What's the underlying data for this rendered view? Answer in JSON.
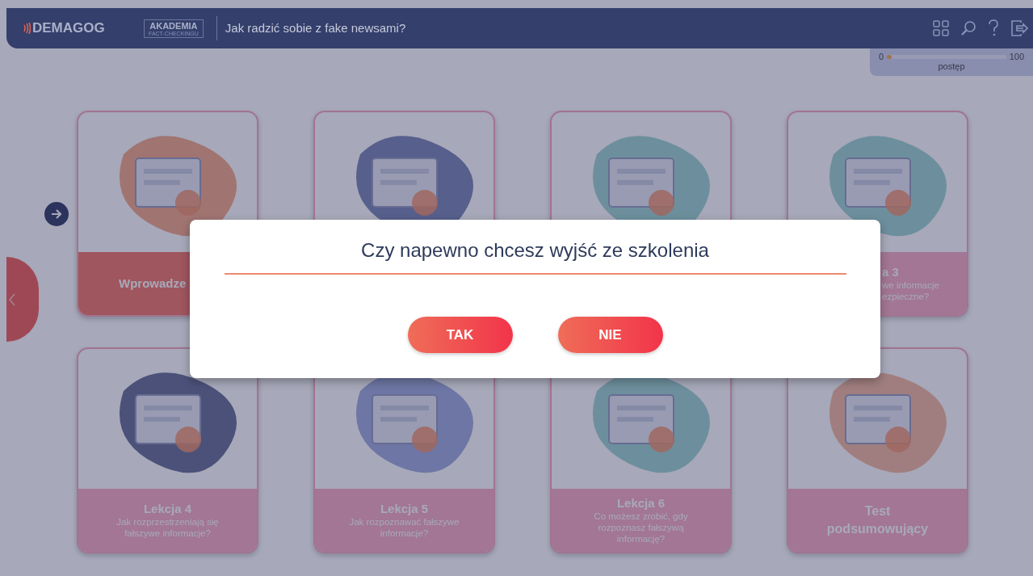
{
  "header": {
    "logo": "DEMAGOG",
    "badge_title": "AKADEMIA",
    "badge_subtitle": "FACT-CHECKINGU",
    "course_title": "Jak radzić sobie z fake newsami?"
  },
  "progress": {
    "min": "0",
    "max": "100",
    "label": "postęp",
    "level": 0.04
  },
  "lessons": [
    {
      "title": "Wprowadze",
      "unlocked": true,
      "kind": "cutright"
    },
    {
      "kind": "hidden"
    },
    {
      "kind": "hidden"
    },
    {
      "title": "a 3",
      "lines": [
        "we informacje",
        "ezpieczne?"
      ],
      "unlocked": false,
      "kind": "cutleft"
    },
    {
      "title": "Lekcja 4",
      "lines": [
        "Jak rozprzestrzeniają się",
        "fałszywe informacje?"
      ],
      "unlocked": false,
      "kind": "lesson"
    },
    {
      "title": "Lekcja 5",
      "lines": [
        "Jak rozpoznawać fałszywe",
        "informacje?"
      ],
      "unlocked": false,
      "kind": "lesson"
    },
    {
      "title": "Lekcja 6",
      "lines": [
        "Co możesz zrobić, gdy",
        "rozpoznasz fałszywą",
        "informację?"
      ],
      "unlocked": false,
      "kind": "lesson"
    },
    {
      "title": "Test podsumowujący",
      "unlocked": false,
      "kind": "test"
    }
  ],
  "dialog": {
    "question": "Czy napewno chcesz wyjść ze szkolenia",
    "buttons": [
      {
        "label": "TAK"
      },
      {
        "label": "NIE"
      }
    ]
  }
}
